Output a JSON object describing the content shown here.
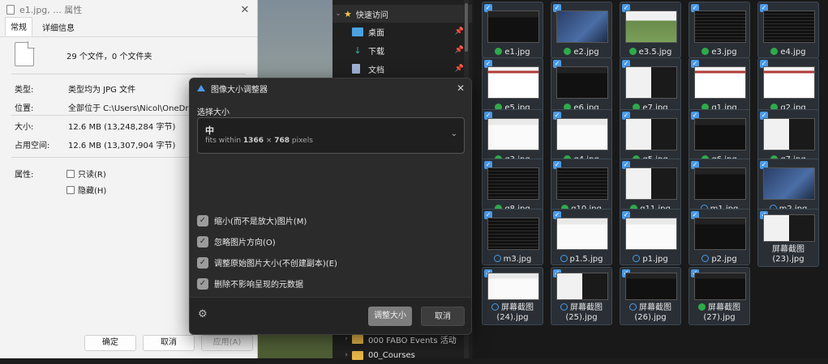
{
  "properties": {
    "title": "e1.jpg, ... 属性",
    "tabs": [
      "常规",
      "详细信息"
    ],
    "file_count": "29 个文件，0 个文件夹",
    "rows": [
      {
        "label": "类型:",
        "value": "类型均为 JPG 文件"
      },
      {
        "label": "位置:",
        "value": "全部位于 C:\\Users\\Nicol\\OneDrive\\De"
      },
      {
        "label": "大小:",
        "value": "12.6 MB (13,248,284 字节)"
      },
      {
        "label": "占用空间:",
        "value": "12.6 MB (13,307,904 字节)"
      }
    ],
    "attributes_label": "属性:",
    "attributes": [
      "只读(R)",
      "隐藏(H)"
    ],
    "buttons": {
      "ok": "确定",
      "cancel": "取消",
      "apply": "应用(A)"
    }
  },
  "sidebar": {
    "quick_access": "快速访问",
    "items": [
      {
        "label": "桌面",
        "icon": "desktop-icon",
        "color": "#4aa3e0"
      },
      {
        "label": "下载",
        "icon": "download-icon",
        "color": "#3fb0a0"
      },
      {
        "label": "文档",
        "icon": "document-icon",
        "color": "#a0b4d8"
      }
    ],
    "folders": [
      "000 FABO Events 活动",
      "00_Courses"
    ]
  },
  "files": [
    {
      "name": "e1.jpg",
      "status": "ok",
      "style": "dark"
    },
    {
      "name": "e2.jpg",
      "status": "ok",
      "style": "blue"
    },
    {
      "name": "e3.5.jpg",
      "status": "ok",
      "style": "photo"
    },
    {
      "name": "e3.jpg",
      "status": "ok",
      "style": "code"
    },
    {
      "name": "e4.jpg",
      "status": "ok",
      "style": "code"
    },
    {
      "name": "e5.jpg",
      "status": "ok",
      "style": "redbar"
    },
    {
      "name": "e6.jpg",
      "status": "ok",
      "style": "dark"
    },
    {
      "name": "e7.jpg",
      "status": "ok",
      "style": "mixed"
    },
    {
      "name": "g1.jpg",
      "status": "ok",
      "style": "redbar"
    },
    {
      "name": "g2.jpg",
      "status": "ok",
      "style": "redbar"
    },
    {
      "name": "g3.jpg",
      "status": "ok",
      "style": "light"
    },
    {
      "name": "g4.jpg",
      "status": "ok",
      "style": "light"
    },
    {
      "name": "g5.jpg",
      "status": "ok",
      "style": "mixed"
    },
    {
      "name": "g6.jpg",
      "status": "ok",
      "style": "dark"
    },
    {
      "name": "g7.jpg",
      "status": "ok",
      "style": "mixed"
    },
    {
      "name": "g8.jpg",
      "status": "ok",
      "style": "code"
    },
    {
      "name": "g10.jpg",
      "status": "ok",
      "style": "code"
    },
    {
      "name": "g11.jpg",
      "status": "ok",
      "style": "mixed"
    },
    {
      "name": "m1.jpg",
      "status": "sync",
      "style": "dark"
    },
    {
      "name": "m2.jpg",
      "status": "sync",
      "style": "blue"
    },
    {
      "name": "m3.jpg",
      "status": "sync",
      "style": "code"
    },
    {
      "name": "p1.5.jpg",
      "status": "sync",
      "style": "light"
    },
    {
      "name": "p1.jpg",
      "status": "sync",
      "style": "light"
    },
    {
      "name": "p2.jpg",
      "status": "sync",
      "style": "dark"
    },
    {
      "name": "屏幕截图 (23).jpg",
      "line1": "屏幕截图",
      "line2": "(23).jpg",
      "status": "none",
      "style": "mixed"
    },
    {
      "name": "屏幕截图 (24).jpg",
      "line1": "屏幕截图",
      "line2": "(24).jpg",
      "status": "sync",
      "style": "light"
    },
    {
      "name": "屏幕截图 (25).jpg",
      "line1": "屏幕截图",
      "line2": "(25).jpg",
      "status": "sync",
      "style": "mixed"
    },
    {
      "name": "屏幕截图 (26).jpg",
      "line1": "屏幕截图",
      "line2": "(26).jpg",
      "status": "sync",
      "style": "dark"
    },
    {
      "name": "屏幕截图 (27).jpg",
      "line1": "屏幕截图",
      "line2": "(27).jpg",
      "status": "ok",
      "style": "dark"
    }
  ],
  "resizer": {
    "title": "图像大小调整器",
    "size_label": "选择大小",
    "selected_size": "中",
    "size_desc_prefix": "fits within ",
    "size_width": "1366",
    "size_times": " × ",
    "size_height": "768",
    "size_desc_suffix": " pixels",
    "options": [
      "缩小(而不是放大)图片(M)",
      "忽略图片方向(O)",
      "调整原始图片大小(不创建副本)(E)",
      "删除不影响呈现的元数据"
    ],
    "resize_button": "调整大小",
    "cancel_button": "取消"
  },
  "colors": {
    "accent": "#4a9ae8",
    "ok": "#2faa4a",
    "dialog_bg": "#2b2b2b"
  }
}
